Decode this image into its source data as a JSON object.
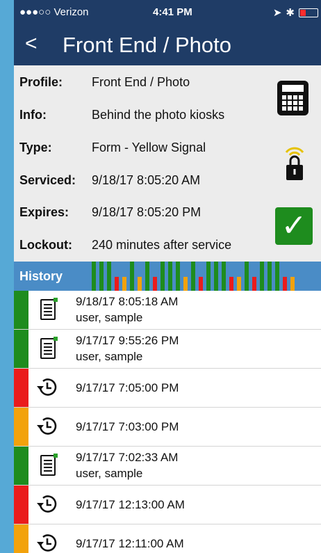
{
  "status": {
    "carrier": "●●●○○ Verizon",
    "time": "4:41 PM"
  },
  "nav": {
    "back": "<",
    "title": "Front End / Photo"
  },
  "info": {
    "profile_label": "Profile:",
    "profile": "Front End / Photo",
    "info_label": "Info:",
    "info": "Behind the photo kiosks",
    "type_label": "Type:",
    "type": "Form - Yellow Signal",
    "serviced_label": "Serviced:",
    "serviced": "9/18/17  8:05:20 AM",
    "expires_label": "Expires:",
    "expires": "9/18/17  8:05:20 PM",
    "lockout_label": "Lockout:",
    "lockout": "240 minutes after service"
  },
  "history": {
    "label": "History",
    "bars": [
      "green",
      "green",
      "green",
      "red",
      "orange",
      "green",
      "orange",
      "green",
      "red",
      "green",
      "green",
      "green",
      "orange",
      "green",
      "red",
      "green",
      "green",
      "green",
      "red",
      "orange",
      "green",
      "red",
      "green",
      "green",
      "green",
      "red",
      "orange"
    ],
    "items": [
      {
        "kind": "form",
        "status": "green",
        "time": "9/18/17  8:05:18 AM",
        "user": "user, sample"
      },
      {
        "kind": "form",
        "status": "green",
        "time": "9/17/17  9:55:26 PM",
        "user": "user, sample"
      },
      {
        "kind": "clock",
        "status": "red",
        "time": "9/17/17  7:05:00 PM",
        "user": ""
      },
      {
        "kind": "clock",
        "status": "orange",
        "time": "9/17/17  7:03:00 PM",
        "user": ""
      },
      {
        "kind": "form",
        "status": "green",
        "time": "9/17/17  7:02:33 AM",
        "user": "user, sample"
      },
      {
        "kind": "clock",
        "status": "red",
        "time": "9/17/17  12:13:00 AM",
        "user": ""
      },
      {
        "kind": "clock",
        "status": "orange",
        "time": "9/17/17  12:11:00 AM",
        "user": ""
      }
    ]
  },
  "colors": {
    "green": "#1e8c1e",
    "red": "#ea1c1c",
    "orange": "#f2a20c",
    "nav": "#1f3c66",
    "history_bar": "#4a8cc6"
  }
}
